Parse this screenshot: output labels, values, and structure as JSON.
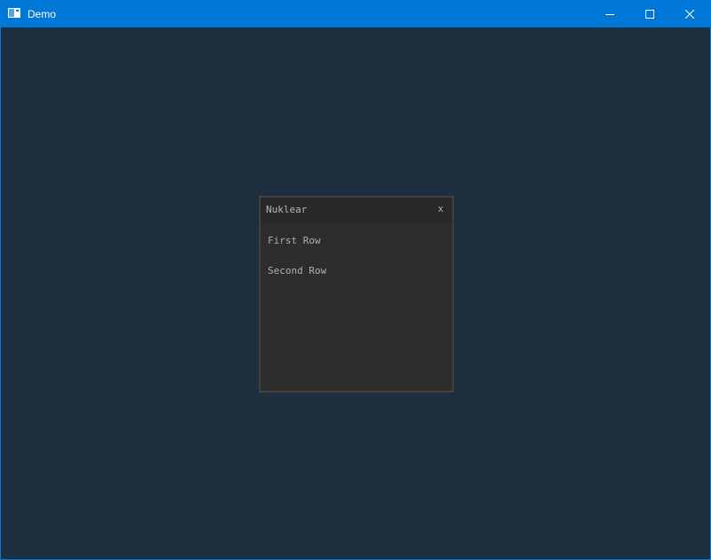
{
  "window": {
    "title": "Demo",
    "icon": "app-window-icon",
    "controls": {
      "minimize_icon": "minimize-icon",
      "maximize_icon": "maximize-icon",
      "close_icon": "close-icon"
    },
    "accent_color": "#0078d7",
    "background_color": "#1d2f3e"
  },
  "nuklear_panel": {
    "title": "Nuklear",
    "close_label": "x",
    "rows": [
      {
        "label": "First Row"
      },
      {
        "label": "Second Row"
      }
    ],
    "background_color": "#2d2d2d",
    "header_color": "#282828",
    "border_color": "#414141"
  }
}
